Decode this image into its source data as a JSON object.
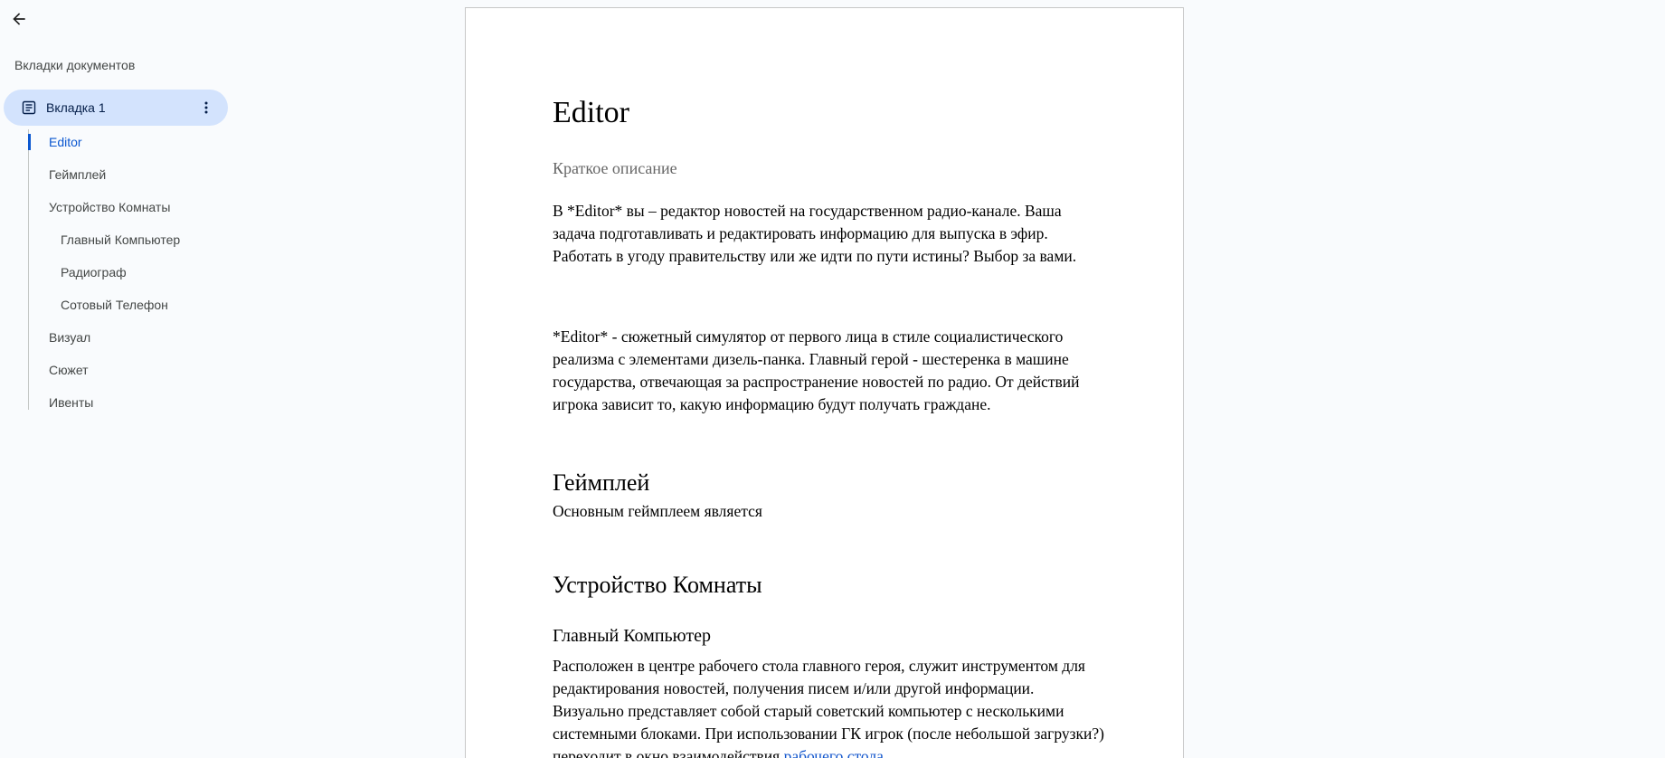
{
  "sidebar": {
    "back_label": "Back",
    "heading": "Вкладки документов",
    "tab": {
      "label": "Вкладка 1",
      "icon": "doc-icon",
      "more_icon": "more-vert-icon"
    },
    "outline": [
      {
        "label": "Editor",
        "level": 1,
        "active": true
      },
      {
        "label": "Геймплей",
        "level": 1,
        "active": false
      },
      {
        "label": "Устройство Комнаты",
        "level": 1,
        "active": false
      },
      {
        "label": "Главный Компьютер",
        "level": 2,
        "active": false
      },
      {
        "label": "Радиограф",
        "level": 2,
        "active": false
      },
      {
        "label": "Сотовый Телефон",
        "level": 2,
        "active": false
      },
      {
        "label": "Визуал",
        "level": 1,
        "active": false
      },
      {
        "label": "Сюжет",
        "level": 1,
        "active": false
      },
      {
        "label": "Ивенты",
        "level": 1,
        "active": false
      }
    ]
  },
  "document": {
    "title": "Editor",
    "subtitle": "Краткое описание",
    "paragraph1": "В *Editor* вы – редактор новостей на государственном радио-канале. Ваша задача подготавливать и редактировать информацию для выпуска в эфир. Работать в угоду правительству или же идти по пути истины? Выбор за вами.",
    "paragraph2": "*Editor* - сюжетный симулятор от первого лица в стиле социалистического реализма с элементами дизель-панка. Главный герой - шестеренка в машине государства, отвечающая за распространение новостей по радио. От действий игрока зависит то, какую информацию будут получать граждане.",
    "gameplay_heading": "Геймплей",
    "gameplay_text": "Основным геймплеем является",
    "room_heading": "Устройство Комнаты",
    "computer_heading": "Главный Компьютер",
    "computer_text": "Расположен в центре рабочего стола главного героя, служит инструментом для редактирования новостей, получения писем и/или другой информации. Визуально представляет собой старый советский компьютер с несколькими системными блоками. При использовании ГК игрок (после небольшой загрузки?) переходит в окно взаимодействия",
    "computer_link": "рабочего стола."
  },
  "colors": {
    "background": "#f9fbfd",
    "tab_active": "#d3e3fd",
    "accent": "#0b57d0",
    "link": "#1155cc"
  }
}
